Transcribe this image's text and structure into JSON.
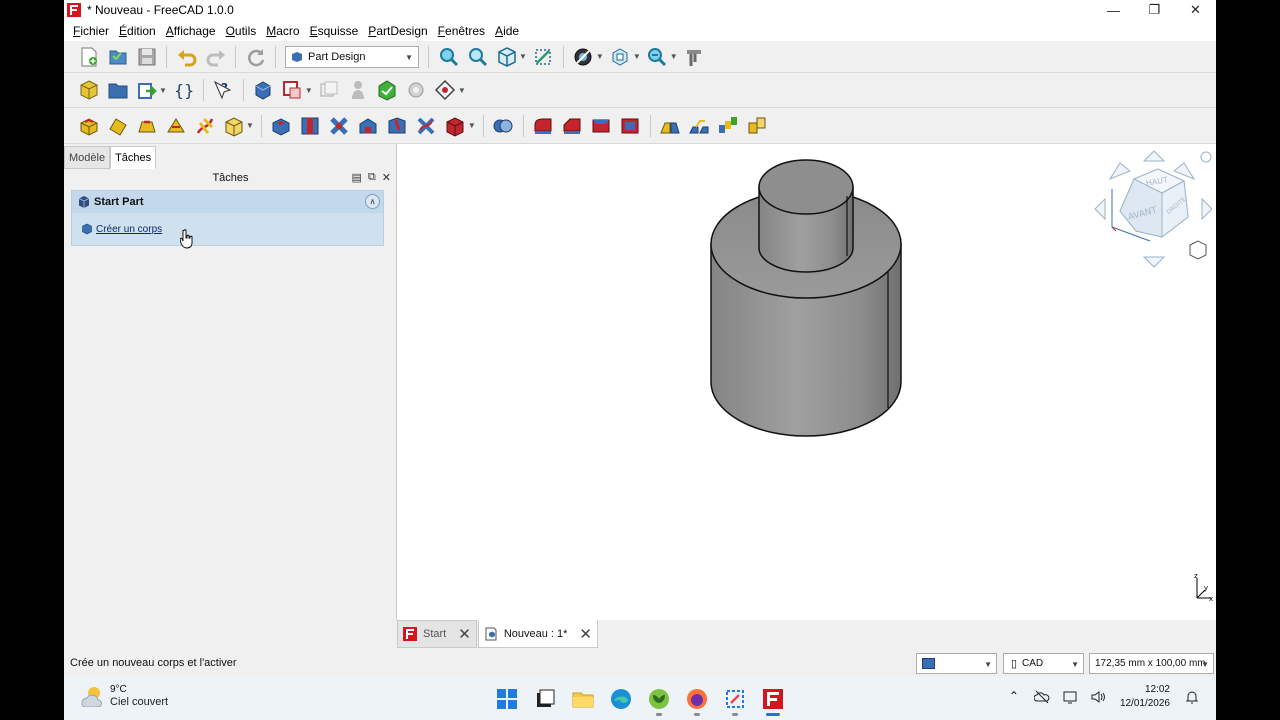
{
  "window": {
    "title": "* Nouveau - FreeCAD 1.0.0",
    "controls": [
      "minimize",
      "maximize",
      "close"
    ]
  },
  "menubar": {
    "items": [
      "Fichier",
      "Édition",
      "Affichage",
      "Outils",
      "Macro",
      "Esquisse",
      "PartDesign",
      "Fenêtres",
      "Aide"
    ]
  },
  "toolbar": {
    "workbench": "Part Design"
  },
  "panel": {
    "tabs": [
      "Modèle",
      "Tâches"
    ],
    "active_tab": "Tâches",
    "header": "Tâches",
    "taskbox": {
      "title": "Start Part",
      "action": "Créer un corps"
    }
  },
  "view3d": {
    "navcube": {
      "top_label": "HAUT",
      "front_label": "AVANT",
      "right_label": "DROITE"
    },
    "axes": {
      "x": "x",
      "y": "y",
      "z": "z"
    }
  },
  "doc_tabs": [
    {
      "label": "Start",
      "active": false
    },
    {
      "label": "Nouveau : 1*",
      "active": true
    }
  ],
  "statusbar": {
    "message": "Crée un nouveau corps et l'activer",
    "nav_style": "CAD",
    "dimensions": "172,35 mm x 100,00 mm"
  },
  "taskbar": {
    "weather": {
      "temp": "9°C",
      "desc": "Ciel couvert"
    },
    "clock": {
      "time": "12:02",
      "date": "12/01/2026"
    },
    "apps": [
      "windows-start",
      "file-explorer-dark",
      "file-explorer",
      "edge",
      "app-green",
      "firefox",
      "snipping-tool",
      "freecad"
    ]
  },
  "colors": {
    "taskbox_bg": "#cfe0ee",
    "part_gray": "#8f8f8f",
    "accent_blue": "#2b6fd1"
  }
}
